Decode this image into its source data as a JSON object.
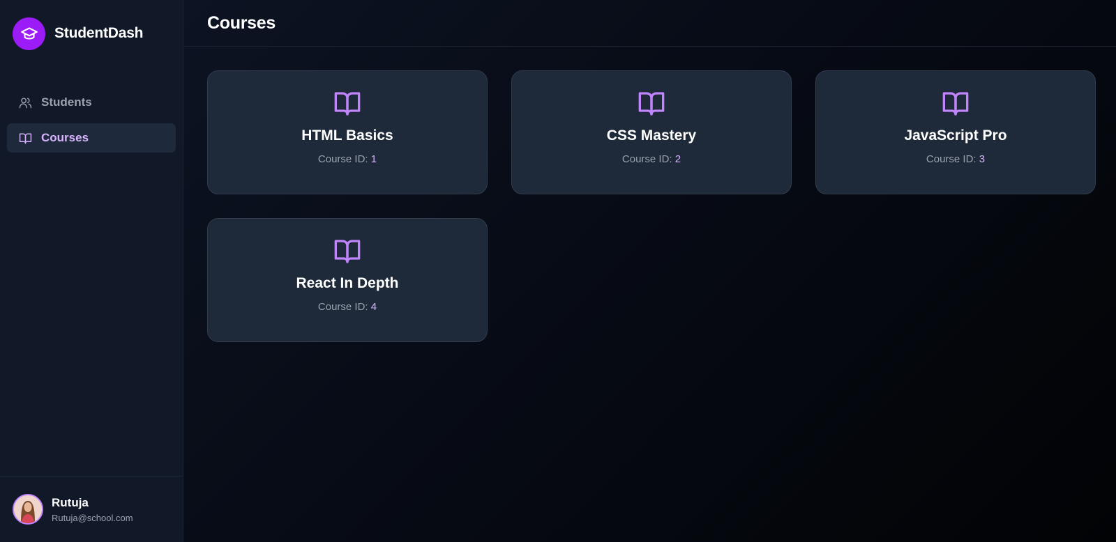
{
  "brand": {
    "name": "StudentDash",
    "icon": "graduation-cap-icon",
    "accent": "#9b1cf6"
  },
  "sidebar": {
    "items": [
      {
        "label": "Students",
        "icon": "users-icon",
        "active": false
      },
      {
        "label": "Courses",
        "icon": "book-open-icon",
        "active": true
      }
    ]
  },
  "header": {
    "title": "Courses"
  },
  "courses": {
    "id_label": "Course ID:",
    "items": [
      {
        "title": "HTML Basics",
        "id": "1"
      },
      {
        "title": "CSS Mastery",
        "id": "2"
      },
      {
        "title": "JavaScript Pro",
        "id": "3"
      },
      {
        "title": "React In Depth",
        "id": "4"
      }
    ]
  },
  "user": {
    "name": "Rutuja",
    "email": "Rutuja@school.com"
  },
  "colors": {
    "sidebar_bg": "#111827",
    "card_bg": "#1e2939",
    "active_accent": "#d8b4fe",
    "icon_accent": "#c084fc"
  }
}
